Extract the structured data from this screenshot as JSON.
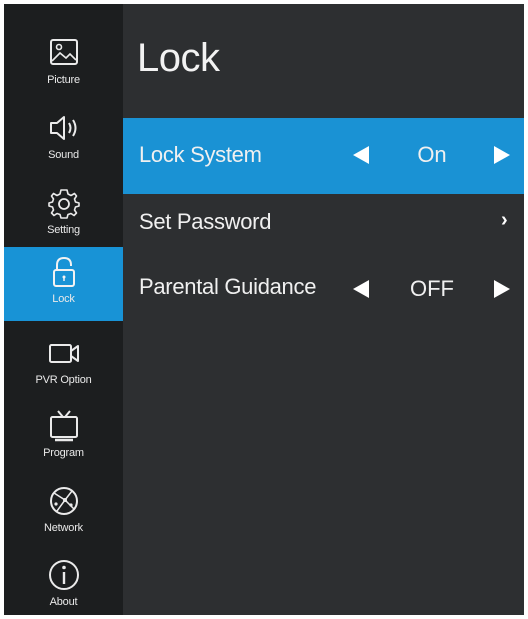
{
  "sidebar": {
    "items": [
      {
        "label": "Picture",
        "icon": "picture-icon"
      },
      {
        "label": "Sound",
        "icon": "speaker-icon"
      },
      {
        "label": "Setting",
        "icon": "gear-icon"
      },
      {
        "label": "Lock",
        "icon": "lock-icon",
        "active": true
      },
      {
        "label": "PVR Option",
        "icon": "camera-icon"
      },
      {
        "label": "Program",
        "icon": "tv-icon"
      },
      {
        "label": "Network",
        "icon": "globe-icon"
      },
      {
        "label": "About",
        "icon": "info-icon"
      }
    ]
  },
  "main": {
    "title": "Lock",
    "rows": [
      {
        "label": "Lock System",
        "value": "On",
        "selected": true
      },
      {
        "label": "Set Password",
        "value": ""
      },
      {
        "label": "Parental Guidance",
        "value": "OFF"
      }
    ]
  },
  "colors": {
    "accent": "#1893d6",
    "sidebar_bg": "#1c1e1f",
    "panel_bg": "#2d2f31",
    "text": "#f0f0f0"
  }
}
